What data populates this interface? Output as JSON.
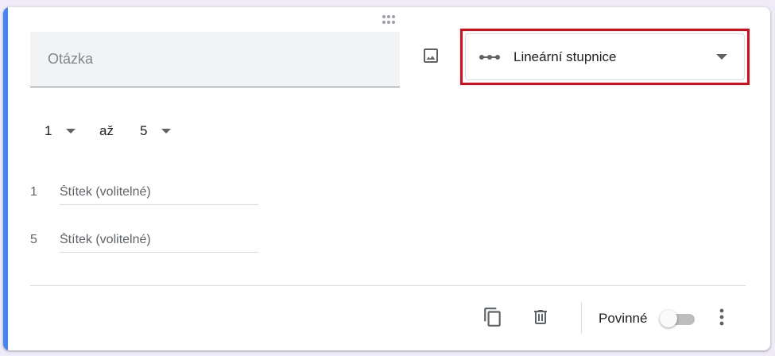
{
  "question": {
    "placeholder": "Otázka"
  },
  "type_select": {
    "selected": "Lineární stupnice",
    "icon": "linear-scale-icon"
  },
  "scale": {
    "from_value": "1",
    "to_word": "až",
    "to_value": "5"
  },
  "labels": [
    {
      "number": "1",
      "placeholder": "Štítek (volitelné)"
    },
    {
      "number": "5",
      "placeholder": "Štítek (volitelné)"
    }
  ],
  "footer": {
    "required_label": "Povinné",
    "required_on": false,
    "icons": [
      "duplicate-icon",
      "delete-icon",
      "more-vert-icon"
    ]
  },
  "colors": {
    "accent": "#4285f4",
    "highlight": "#e30613",
    "icon": "#5f6368"
  }
}
